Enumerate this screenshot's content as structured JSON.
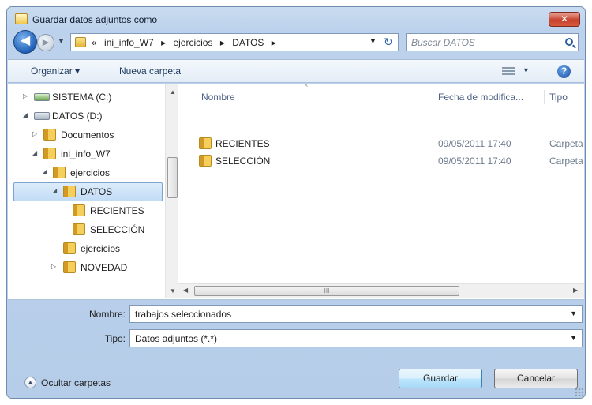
{
  "window": {
    "title": "Guardar datos adjuntos como",
    "close_label": "✕"
  },
  "nav": {
    "back_label": "◀",
    "forward_label": "▶",
    "history_dropdown": "▼"
  },
  "address": {
    "crumbs": [
      "«",
      "ini_info_W7",
      "▸",
      "ejercicios",
      "▸",
      "DATOS",
      "▸"
    ],
    "dropdown": "▼",
    "refresh": "↻"
  },
  "search": {
    "placeholder": "Buscar DATOS"
  },
  "toolbar": {
    "organize_label": "Organizar ▾",
    "new_folder_label": "Nueva carpeta",
    "view_dropdown": "▼",
    "help_label": "?"
  },
  "tree": {
    "items": [
      {
        "label": "SISTEMA (C:)",
        "arrow": "▷",
        "kind": "drive-sys"
      },
      {
        "label": "DATOS (D:)",
        "arrow": "◢",
        "kind": "drive"
      },
      {
        "label": "Documentos",
        "arrow": "▷",
        "kind": "folder"
      },
      {
        "label": "ini_info_W7",
        "arrow": "◢",
        "kind": "folder"
      },
      {
        "label": "ejercicios",
        "arrow": "◢",
        "kind": "folder"
      },
      {
        "label": "DATOS",
        "arrow": "◢",
        "kind": "folder",
        "selected": true
      },
      {
        "label": "RECIENTES",
        "arrow": "",
        "kind": "folder"
      },
      {
        "label": "SELECCIÓN",
        "arrow": "",
        "kind": "folder"
      },
      {
        "label": "ejercicios",
        "arrow": "",
        "kind": "folder"
      },
      {
        "label": "NOVEDAD",
        "arrow": "▷",
        "kind": "folder"
      }
    ]
  },
  "scroll": {
    "up": "▲",
    "down": "▼",
    "left": "◀",
    "right": "▶",
    "thumb_grip_v": "≡",
    "thumb_grip_h": "III"
  },
  "files": {
    "columns": {
      "name": "Nombre",
      "date": "Fecha de modifica...",
      "type": "Tipo",
      "sort_indicator": "^"
    },
    "rows": [
      {
        "name": "RECIENTES",
        "date": "09/05/2011 17:40",
        "type": "Carpeta de archivos"
      },
      {
        "name": "SELECCIÓN",
        "date": "09/05/2011 17:40",
        "type": "Carpeta de archivos"
      }
    ]
  },
  "form": {
    "name_label": "Nombre:",
    "name_value": "trabajos seleccionados",
    "type_label": "Tipo:",
    "type_value": "Datos adjuntos (*.*)",
    "dropdown": "▼"
  },
  "footer": {
    "hide_folders_icon": "▲",
    "hide_folders_label": "Ocultar carpetas",
    "save_label": "Guardar",
    "cancel_label": "Cancelar"
  }
}
